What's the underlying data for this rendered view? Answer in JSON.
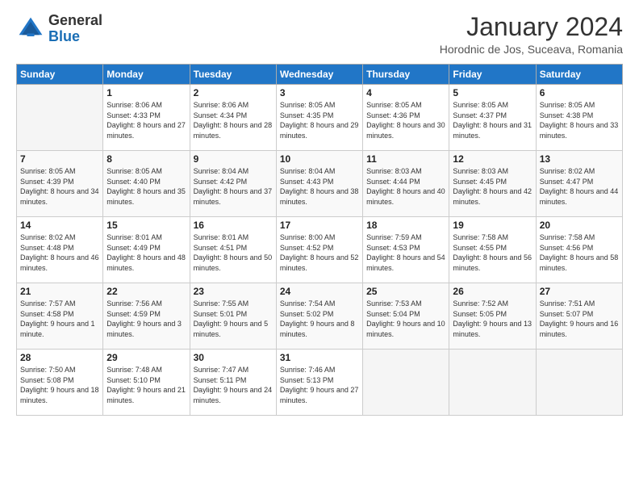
{
  "header": {
    "logo_general": "General",
    "logo_blue": "Blue",
    "month_title": "January 2024",
    "location": "Horodnic de Jos, Suceava, Romania"
  },
  "days_of_week": [
    "Sunday",
    "Monday",
    "Tuesday",
    "Wednesday",
    "Thursday",
    "Friday",
    "Saturday"
  ],
  "weeks": [
    [
      {
        "day": "",
        "empty": true
      },
      {
        "day": "1",
        "sunrise": "Sunrise: 8:06 AM",
        "sunset": "Sunset: 4:33 PM",
        "daylight": "Daylight: 8 hours and 27 minutes."
      },
      {
        "day": "2",
        "sunrise": "Sunrise: 8:06 AM",
        "sunset": "Sunset: 4:34 PM",
        "daylight": "Daylight: 8 hours and 28 minutes."
      },
      {
        "day": "3",
        "sunrise": "Sunrise: 8:05 AM",
        "sunset": "Sunset: 4:35 PM",
        "daylight": "Daylight: 8 hours and 29 minutes."
      },
      {
        "day": "4",
        "sunrise": "Sunrise: 8:05 AM",
        "sunset": "Sunset: 4:36 PM",
        "daylight": "Daylight: 8 hours and 30 minutes."
      },
      {
        "day": "5",
        "sunrise": "Sunrise: 8:05 AM",
        "sunset": "Sunset: 4:37 PM",
        "daylight": "Daylight: 8 hours and 31 minutes."
      },
      {
        "day": "6",
        "sunrise": "Sunrise: 8:05 AM",
        "sunset": "Sunset: 4:38 PM",
        "daylight": "Daylight: 8 hours and 33 minutes."
      }
    ],
    [
      {
        "day": "7",
        "sunrise": "Sunrise: 8:05 AM",
        "sunset": "Sunset: 4:39 PM",
        "daylight": "Daylight: 8 hours and 34 minutes."
      },
      {
        "day": "8",
        "sunrise": "Sunrise: 8:05 AM",
        "sunset": "Sunset: 4:40 PM",
        "daylight": "Daylight: 8 hours and 35 minutes."
      },
      {
        "day": "9",
        "sunrise": "Sunrise: 8:04 AM",
        "sunset": "Sunset: 4:42 PM",
        "daylight": "Daylight: 8 hours and 37 minutes."
      },
      {
        "day": "10",
        "sunrise": "Sunrise: 8:04 AM",
        "sunset": "Sunset: 4:43 PM",
        "daylight": "Daylight: 8 hours and 38 minutes."
      },
      {
        "day": "11",
        "sunrise": "Sunrise: 8:03 AM",
        "sunset": "Sunset: 4:44 PM",
        "daylight": "Daylight: 8 hours and 40 minutes."
      },
      {
        "day": "12",
        "sunrise": "Sunrise: 8:03 AM",
        "sunset": "Sunset: 4:45 PM",
        "daylight": "Daylight: 8 hours and 42 minutes."
      },
      {
        "day": "13",
        "sunrise": "Sunrise: 8:02 AM",
        "sunset": "Sunset: 4:47 PM",
        "daylight": "Daylight: 8 hours and 44 minutes."
      }
    ],
    [
      {
        "day": "14",
        "sunrise": "Sunrise: 8:02 AM",
        "sunset": "Sunset: 4:48 PM",
        "daylight": "Daylight: 8 hours and 46 minutes."
      },
      {
        "day": "15",
        "sunrise": "Sunrise: 8:01 AM",
        "sunset": "Sunset: 4:49 PM",
        "daylight": "Daylight: 8 hours and 48 minutes."
      },
      {
        "day": "16",
        "sunrise": "Sunrise: 8:01 AM",
        "sunset": "Sunset: 4:51 PM",
        "daylight": "Daylight: 8 hours and 50 minutes."
      },
      {
        "day": "17",
        "sunrise": "Sunrise: 8:00 AM",
        "sunset": "Sunset: 4:52 PM",
        "daylight": "Daylight: 8 hours and 52 minutes."
      },
      {
        "day": "18",
        "sunrise": "Sunrise: 7:59 AM",
        "sunset": "Sunset: 4:53 PM",
        "daylight": "Daylight: 8 hours and 54 minutes."
      },
      {
        "day": "19",
        "sunrise": "Sunrise: 7:58 AM",
        "sunset": "Sunset: 4:55 PM",
        "daylight": "Daylight: 8 hours and 56 minutes."
      },
      {
        "day": "20",
        "sunrise": "Sunrise: 7:58 AM",
        "sunset": "Sunset: 4:56 PM",
        "daylight": "Daylight: 8 hours and 58 minutes."
      }
    ],
    [
      {
        "day": "21",
        "sunrise": "Sunrise: 7:57 AM",
        "sunset": "Sunset: 4:58 PM",
        "daylight": "Daylight: 9 hours and 1 minute."
      },
      {
        "day": "22",
        "sunrise": "Sunrise: 7:56 AM",
        "sunset": "Sunset: 4:59 PM",
        "daylight": "Daylight: 9 hours and 3 minutes."
      },
      {
        "day": "23",
        "sunrise": "Sunrise: 7:55 AM",
        "sunset": "Sunset: 5:01 PM",
        "daylight": "Daylight: 9 hours and 5 minutes."
      },
      {
        "day": "24",
        "sunrise": "Sunrise: 7:54 AM",
        "sunset": "Sunset: 5:02 PM",
        "daylight": "Daylight: 9 hours and 8 minutes."
      },
      {
        "day": "25",
        "sunrise": "Sunrise: 7:53 AM",
        "sunset": "Sunset: 5:04 PM",
        "daylight": "Daylight: 9 hours and 10 minutes."
      },
      {
        "day": "26",
        "sunrise": "Sunrise: 7:52 AM",
        "sunset": "Sunset: 5:05 PM",
        "daylight": "Daylight: 9 hours and 13 minutes."
      },
      {
        "day": "27",
        "sunrise": "Sunrise: 7:51 AM",
        "sunset": "Sunset: 5:07 PM",
        "daylight": "Daylight: 9 hours and 16 minutes."
      }
    ],
    [
      {
        "day": "28",
        "sunrise": "Sunrise: 7:50 AM",
        "sunset": "Sunset: 5:08 PM",
        "daylight": "Daylight: 9 hours and 18 minutes."
      },
      {
        "day": "29",
        "sunrise": "Sunrise: 7:48 AM",
        "sunset": "Sunset: 5:10 PM",
        "daylight": "Daylight: 9 hours and 21 minutes."
      },
      {
        "day": "30",
        "sunrise": "Sunrise: 7:47 AM",
        "sunset": "Sunset: 5:11 PM",
        "daylight": "Daylight: 9 hours and 24 minutes."
      },
      {
        "day": "31",
        "sunrise": "Sunrise: 7:46 AM",
        "sunset": "Sunset: 5:13 PM",
        "daylight": "Daylight: 9 hours and 27 minutes."
      },
      {
        "day": "",
        "empty": true
      },
      {
        "day": "",
        "empty": true
      },
      {
        "day": "",
        "empty": true
      }
    ]
  ]
}
